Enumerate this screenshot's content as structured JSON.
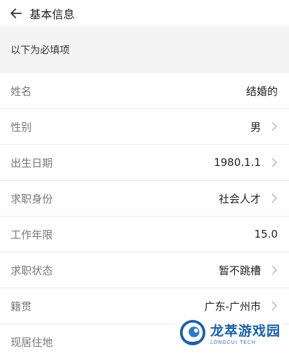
{
  "header": {
    "title": "基本信息",
    "back_icon": "arrow-left-icon"
  },
  "section": {
    "label": "以下为必填项"
  },
  "fields": [
    {
      "label": "姓名",
      "value": "结婚的"
    },
    {
      "label": "性别",
      "value": "男"
    },
    {
      "label": "出生日期",
      "value": "1980.1.1"
    },
    {
      "label": "求职身份",
      "value": "社会人才"
    },
    {
      "label": "工作年限",
      "value": "15.0"
    },
    {
      "label": "求职状态",
      "value": "暂不跳槽"
    },
    {
      "label": "籍贯",
      "value": "广东-广州市"
    },
    {
      "label": "现居住地",
      "value": ""
    }
  ],
  "watermark": {
    "name": "龙萃游戏园",
    "subtitle": "LONGCUI TECH"
  },
  "colors": {
    "section_bg": "#f4f4f4",
    "label": "#777777",
    "value": "#222222",
    "brand": "#1b5fa8"
  }
}
